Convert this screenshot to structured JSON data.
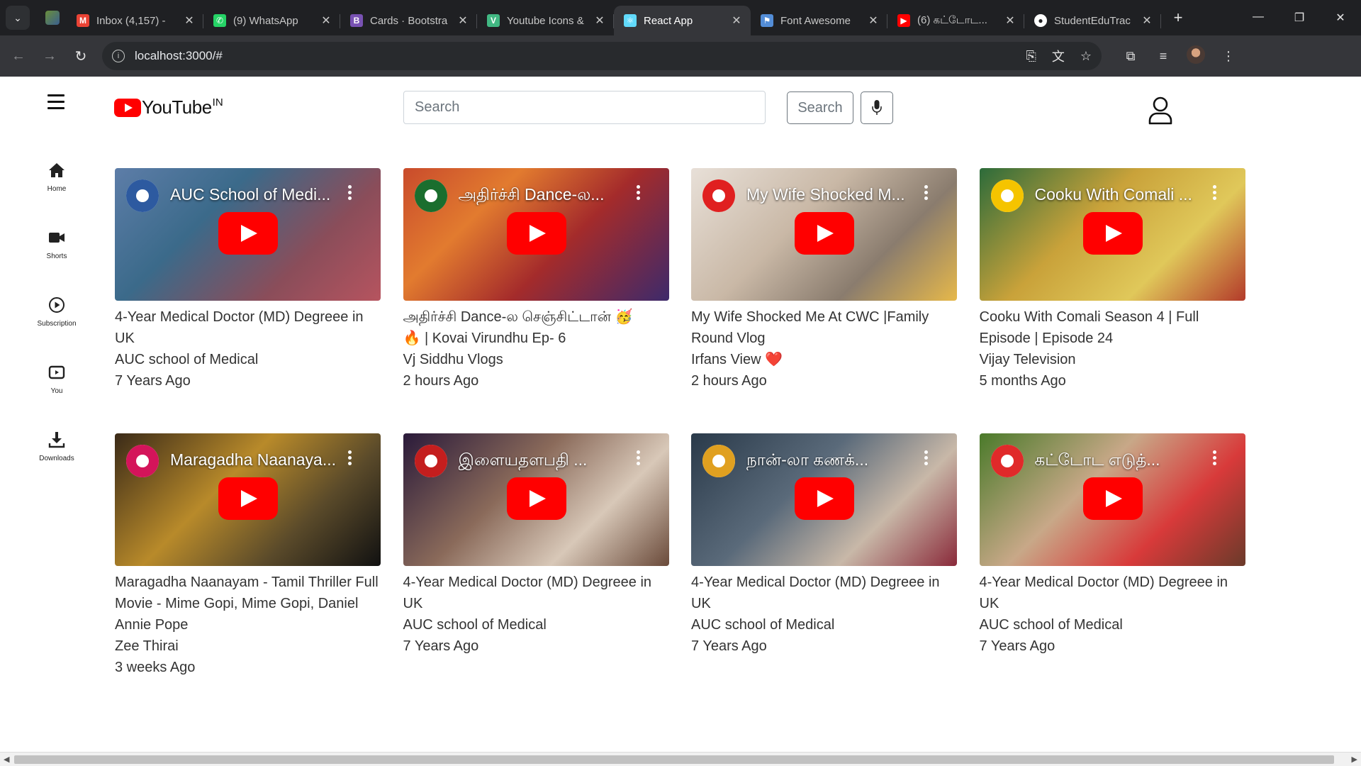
{
  "browser": {
    "tabs": [
      {
        "title": "Inbox (4,157) - ",
        "fav_color": "#ea4335",
        "fav_text": "M",
        "active": false
      },
      {
        "title": "(9) WhatsApp",
        "fav_color": "#25d366",
        "fav_text": "✆",
        "active": false
      },
      {
        "title": "Cards · Bootstra",
        "fav_color": "#7952b3",
        "fav_text": "B",
        "active": false
      },
      {
        "title": "Youtube Icons &",
        "fav_color": "#41b883",
        "fav_text": "V",
        "active": false
      },
      {
        "title": "React App",
        "fav_color": "#61dafb",
        "fav_text": "⚛",
        "active": true
      },
      {
        "title": "Font Awesome",
        "fav_color": "#538dd7",
        "fav_text": "⚑",
        "active": false
      },
      {
        "title": "(6) கட்டோட...",
        "fav_color": "#ff0000",
        "fav_text": "▶",
        "active": false
      },
      {
        "title": "StudentEduTrac",
        "fav_color": "#ffffff",
        "fav_text": "●",
        "active": false
      }
    ],
    "url": "localhost:3000/#"
  },
  "header": {
    "logo_text": "YouTube",
    "logo_sup": "IN",
    "search_placeholder": "Search",
    "search_button": "Search"
  },
  "sidebar": [
    {
      "label": "Home",
      "icon": "home-icon"
    },
    {
      "label": "Shorts",
      "icon": "video-camera-icon"
    },
    {
      "label": "Subscription",
      "icon": "play-circle-icon"
    },
    {
      "label": "You",
      "icon": "youtube-icon"
    },
    {
      "label": "Downloads",
      "icon": "download-icon"
    }
  ],
  "videos": [
    {
      "thumb_title": "AUC School of Medi...",
      "line1": "4-Year Medical Doctor (MD) Degreee in",
      "line2": "UK",
      "channel": "AUC school of Medical",
      "time": "7 Years Ago",
      "bg": "linear-gradient(135deg,#5d7da8 0%,#3b6a8a 35%,#8a4d5a 70%,#b6545f 100%)",
      "ch_color": "#2d5aa0"
    },
    {
      "thumb_title": "அதிர்ச்சி Dance-ல...",
      "line1": "அதிர்ச்சி Dance-ல செஞ்சிட்டான் 🥳",
      "line2": "🔥 | Kovai Virundhu Ep- 6",
      "channel": "Vj Siddhu Vlogs",
      "time": "2 hours Ago",
      "bg": "linear-gradient(135deg,#c94b2c 0%,#e27b2f 30%,#a42b2b 60%,#3d2a6b 100%)",
      "ch_color": "#1a6e2e"
    },
    {
      "thumb_title": "My Wife Shocked M...",
      "line1": "My Wife Shocked Me At CWC |Family",
      "line2": "Round Vlog",
      "channel": "Irfans View ❤️",
      "time": "2 hours Ago",
      "bg": "linear-gradient(135deg,#e8e0d8 0%,#c9b8a6 40%,#8a7c6e 70%,#e6b84a 100%)",
      "ch_color": "#e02020"
    },
    {
      "thumb_title": "Cooku With Comali ...",
      "line1": "Cooku With Comali Season 4 | Full",
      "line2": "Episode | Episode 24",
      "channel": "Vijay Television",
      "time": "5 months Ago",
      "bg": "linear-gradient(135deg,#2c6b3a 0%,#c9a23a 40%,#e0c85a 70%,#b33a2a 100%)",
      "ch_color": "#f5c400"
    },
    {
      "thumb_title": "Maragadha Naanaya...",
      "line1": "Maragadha Naanayam - Tamil Thriller Full",
      "line2": "Movie - Mime Gopi, Mime Gopi, Daniel",
      "line3": "Annie Pope",
      "channel": "Zee Thirai",
      "time": "3 weeks Ago",
      "bg": "linear-gradient(135deg,#3a2a18 0%,#b88a2a 40%,#5a4a2a 70%,#111111 100%)",
      "ch_color": "#d4145a"
    },
    {
      "thumb_title": "இளையதளபதி ...",
      "line1": "4-Year Medical Doctor (MD) Degreee in",
      "line2": "UK",
      "channel": "AUC school of Medical",
      "time": "7 Years Ago",
      "bg": "linear-gradient(135deg,#2a1a3a 0%,#8a6a5a 40%,#d8c8b8 70%,#6a4a3a 100%)",
      "ch_color": "#c41e1e"
    },
    {
      "thumb_title": "நான்-லா கணக்...",
      "line1": "4-Year Medical Doctor (MD) Degreee in",
      "line2": "UK",
      "channel": "AUC school of Medical",
      "time": "7 Years Ago",
      "bg": "linear-gradient(135deg,#2a3a4a 0%,#5a6a7a 40%,#c8b8a8 70%,#8a2a3a 100%)",
      "ch_color": "#e0a020"
    },
    {
      "thumb_title": "கட்டோட எடுத்...",
      "line1": "4-Year Medical Doctor (MD) Degreee in",
      "line2": "UK",
      "channel": "AUC school of Medical",
      "time": "7 Years Ago",
      "bg": "linear-gradient(135deg,#4a7a2a 0%,#c8a888 40%,#d83a3a 70%,#6a3a2a 100%)",
      "ch_color": "#e02a2a"
    }
  ]
}
